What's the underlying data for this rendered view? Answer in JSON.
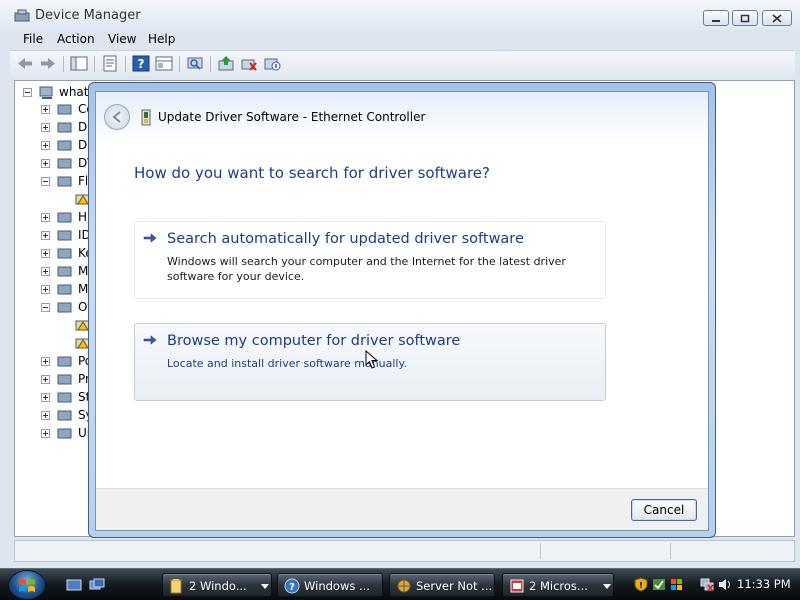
{
  "device_manager": {
    "title": "Device Manager",
    "menu": [
      "File",
      "Action",
      "View",
      "Help"
    ],
    "tree": {
      "root": "whatt",
      "items": [
        {
          "label": "Co",
          "exp": "plus"
        },
        {
          "label": "Di",
          "exp": "plus"
        },
        {
          "label": "Di",
          "exp": "plus"
        },
        {
          "label": "DV",
          "exp": "plus"
        },
        {
          "label": "Fl",
          "exp": "minus"
        },
        {
          "label": "",
          "exp": "none"
        },
        {
          "label": "Hu",
          "exp": "plus"
        },
        {
          "label": "ID",
          "exp": "plus"
        },
        {
          "label": "Ke",
          "exp": "plus"
        },
        {
          "label": "M",
          "exp": "plus"
        },
        {
          "label": "M",
          "exp": "plus"
        },
        {
          "label": "Ot",
          "exp": "minus"
        },
        {
          "label": "",
          "exp": "none"
        },
        {
          "label": "",
          "exp": "none"
        },
        {
          "label": "Po",
          "exp": "plus"
        },
        {
          "label": "Pr",
          "exp": "plus"
        },
        {
          "label": "St",
          "exp": "plus"
        },
        {
          "label": "Sy",
          "exp": "plus"
        },
        {
          "label": "Ur",
          "exp": "plus"
        }
      ]
    }
  },
  "dialog": {
    "title": "Update Driver Software - Ethernet Controller",
    "heading": "How do you want to search for driver software?",
    "option_auto": {
      "title": "Search automatically for updated driver software",
      "description": "Windows will search your computer and the Internet for the latest driver software for your device."
    },
    "option_browse": {
      "title": "Browse my computer for driver software",
      "description": "Locate and install driver software manually."
    },
    "cancel_label": "Cancel"
  },
  "taskbar": {
    "tasks": [
      {
        "label": "2 Windo...",
        "icon": "folder-icon",
        "has_menu": true
      },
      {
        "label": "Windows ...",
        "icon": "help-icon",
        "has_menu": false
      },
      {
        "label": "Server Not ...",
        "icon": "network-icon",
        "has_menu": false
      },
      {
        "label": "2 Micros...",
        "icon": "app-icon",
        "has_menu": true
      }
    ],
    "clock": "11:33 PM"
  },
  "colors": {
    "dialog_heading": "#1e3d8f",
    "option_link": "#1b3b8e",
    "taskbar": "#151a20"
  }
}
